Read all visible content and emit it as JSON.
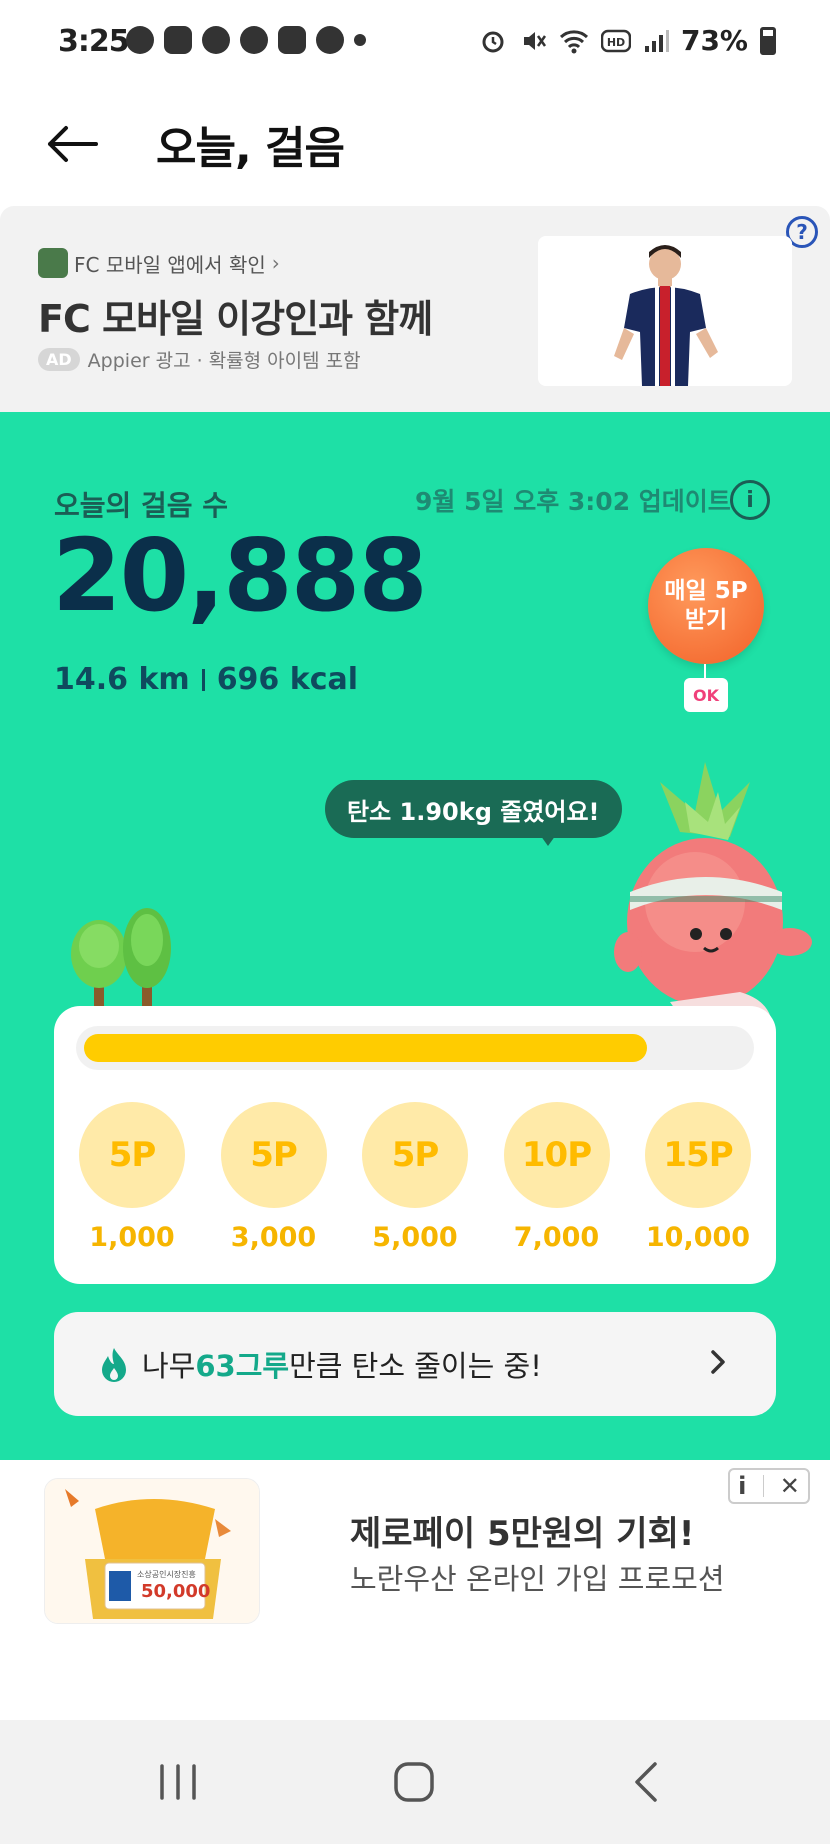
{
  "status_bar": {
    "time": "3:25",
    "battery": "73%"
  },
  "header": {
    "title": "오늘, 걸음",
    "back_icon": "arrow-left-icon"
  },
  "top_ad": {
    "source": "FC 모바일 앱에서 확인",
    "title": "FC 모바일 이강인과 함께",
    "badge": "AD",
    "meta": "Appier 광고 · 확률형 아이템 포함",
    "help": "?"
  },
  "steps": {
    "label": "오늘의 걸음 수",
    "updated": "9월 5일 오후 3:02 업데이트",
    "info": "i",
    "count": "20,888",
    "distance": "14.6 km",
    "calories": "696 kcal"
  },
  "daily_badge": {
    "line1": "매일 5P",
    "line2": "받기",
    "logo": "OK"
  },
  "speech": {
    "text": "탄소 1.90kg 줄였어요!"
  },
  "progress": {
    "fill_fraction": 0.85,
    "milestones": [
      {
        "reward": "5P",
        "steps": "1,000"
      },
      {
        "reward": "5P",
        "steps": "3,000"
      },
      {
        "reward": "5P",
        "steps": "5,000"
      },
      {
        "reward": "10P",
        "steps": "7,000"
      },
      {
        "reward": "15P",
        "steps": "10,000"
      }
    ]
  },
  "tree_card": {
    "prefix": "나무 ",
    "highlight": "63그루",
    "suffix": " 만큼 탄소 줄이는 중!"
  },
  "bottom_ad": {
    "title": "제로페이 5만원의 기회!",
    "subtitle": "노란우산 온라인 가입 프로모션",
    "info": "i",
    "close": "✕",
    "image_amount": "50,000"
  },
  "colors": {
    "main_green": "#1ee0a6",
    "progress_yellow": "#ffcc00",
    "coin_bg": "#ffeaa8",
    "daily_orange": "#f26128",
    "speech_green": "#1a6b55"
  }
}
